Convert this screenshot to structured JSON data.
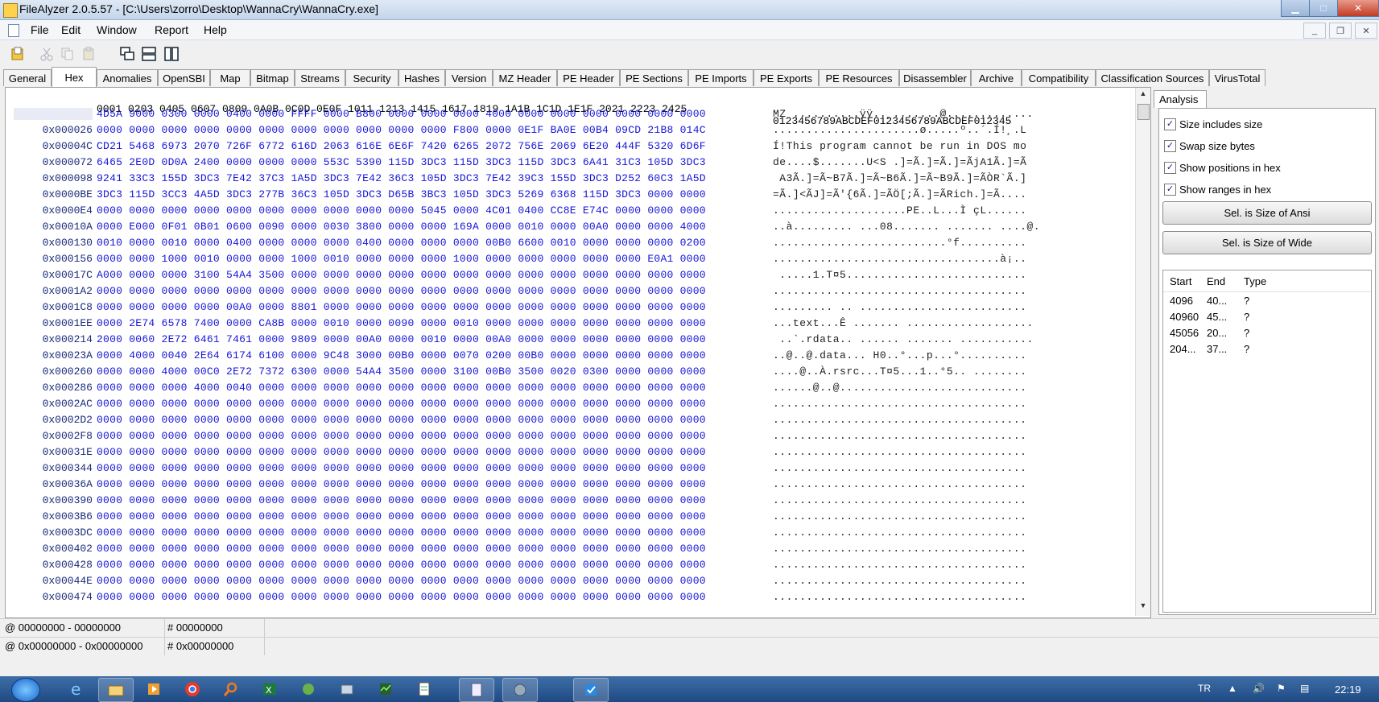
{
  "window": {
    "title": "FileAlyzer 2.0.5.57 - [C:\\Users\\zorro\\Desktop\\WannaCry\\WannaCry.exe]"
  },
  "menu": [
    "File",
    "Edit",
    "Window",
    "Report",
    "Help"
  ],
  "tabs": [
    "General",
    "Hex",
    "Anomalies",
    "OpenSBI",
    "Map",
    "Bitmap",
    "Streams",
    "Security",
    "Hashes",
    "Version",
    "MZ Header",
    "PE Header",
    "PE Sections",
    "PE Imports",
    "PE Exports",
    "PE Resources",
    "Disassembler",
    "Archive",
    "Compatibility",
    "Classification Sources",
    "VirusTotal"
  ],
  "active_tab": "Hex",
  "hex": {
    "header_hex": "0001 0203 0405 0607 0809 0A0B 0C0D 0E0F 1011 1213 1415 1617 1819 1A1B 1C1D 1E1F 2021 2223 2425",
    "header_ascii": "0123456789ABCDEF0123456789ABCDEF012345",
    "rows": [
      {
        "offset": "0x000000",
        "hex": "4D5A 9000 0300 0000 0400 0000 FFFF 0000 B800 0000 0000 0000 4000 0000 0000 0000 0000 0000 0000",
        "ascii": "MZ ..........ÿÿ..¸.......@............."
      },
      {
        "offset": "0x000026",
        "hex": "0000 0000 0000 0000 0000 0000 0000 0000 0000 0000 0000 F800 0000 0E1F BA0E 00B4 09CD 21B8 014C",
        "ascii": "......................ø.....º..´.Í!¸.L"
      },
      {
        "offset": "0x00004C",
        "hex": "CD21 5468 6973 2070 726F 6772 616D 2063 616E 6E6F 7420 6265 2072 756E 2069 6E20 444F 5320 6D6F",
        "ascii": "Í!This program cannot be run in DOS mo"
      },
      {
        "offset": "0x000072",
        "hex": "6465 2E0D 0D0A 2400 0000 0000 0000 553C 5390 115D 3DC3 115D 3DC3 115D 3DC3 6A41 31C3 105D 3DC3",
        "ascii": "de....$.......U<S .]=Ã.]=Ã.]=ÃjA1Ã.]=Ã"
      },
      {
        "offset": "0x000098",
        "hex": "9241 33C3 155D 3DC3 7E42 37C3 1A5D 3DC3 7E42 36C3 105D 3DC3 7E42 39C3 155D 3DC3 D252 60C3 1A5D",
        "ascii": " A3Ã.]=Ã~B7Ã.]=Ã~B6Ã.]=Ã~B9Ã.]=ÃÒR`Ã.]"
      },
      {
        "offset": "0x0000BE",
        "hex": "3DC3 115D 3CC3 4A5D 3DC3 277B 36C3 105D 3DC3 D65B 3BC3 105D 3DC3 5269 6368 115D 3DC3 0000 0000",
        "ascii": "=Ã.]<ÃJ]=Ã'{6Ã.]=ÃÖ[;Ã.]=ÃRich.]=Ã...."
      },
      {
        "offset": "0x0000E4",
        "hex": "0000 0000 0000 0000 0000 0000 0000 0000 0000 0000 5045 0000 4C01 0400 CC8E E74C 0000 0000 0000",
        "ascii": "....................PE..L...Ì çL......"
      },
      {
        "offset": "0x00010A",
        "hex": "0000 E000 0F01 0B01 0600 0090 0000 0030 3800 0000 0000 169A 0000 0010 0000 00A0 0000 0000 4000",
        "ascii": "..à......... ...08....... ....... ....@."
      },
      {
        "offset": "0x000130",
        "hex": "0010 0000 0010 0000 0400 0000 0000 0000 0400 0000 0000 0000 00B0 6600 0010 0000 0000 0000 0200",
        "ascii": "..........................°f.........."
      },
      {
        "offset": "0x000156",
        "hex": "0000 0000 1000 0010 0000 0000 1000 0010 0000 0000 0000 1000 0000 0000 0000 0000 0000 E0A1 0000",
        "ascii": "..................................à¡.."
      },
      {
        "offset": "0x00017C",
        "hex": "A000 0000 0000 3100 54A4 3500 0000 0000 0000 0000 0000 0000 0000 0000 0000 0000 0000 0000 0000",
        "ascii": " .....1.T¤5..........................."
      },
      {
        "offset": "0x0001A2",
        "hex": "0000 0000 0000 0000 0000 0000 0000 0000 0000 0000 0000 0000 0000 0000 0000 0000 0000 0000 0000",
        "ascii": "......................................"
      },
      {
        "offset": "0x0001C8",
        "hex": "0000 0000 0000 0000 00A0 0000 8801 0000 0000 0000 0000 0000 0000 0000 0000 0000 0000 0000 0000",
        "ascii": "......... .. ........................."
      },
      {
        "offset": "0x0001EE",
        "hex": "0000 2E74 6578 7400 0000 CA8B 0000 0010 0000 0090 0000 0010 0000 0000 0000 0000 0000 0000 0000",
        "ascii": "...text...Ê ....... ..................."
      },
      {
        "offset": "0x000214",
        "hex": "2000 0060 2E72 6461 7461 0000 9809 0000 00A0 0000 0010 0000 00A0 0000 0000 0000 0000 0000 0000",
        "ascii": " ..`.rdata.. ...... ....... ..........."
      },
      {
        "offset": "0x00023A",
        "hex": "0000 4000 0040 2E64 6174 6100 0000 9C48 3000 00B0 0000 0070 0200 00B0 0000 0000 0000 0000 0000",
        "ascii": "..@..@.data... H0..°...p...°.........."
      },
      {
        "offset": "0x000260",
        "hex": "0000 0000 4000 00C0 2E72 7372 6300 0000 54A4 3500 0000 3100 00B0 3500 0020 0300 0000 0000 0000",
        "ascii": "....@..À.rsrc...T¤5...1..°5.. ........"
      },
      {
        "offset": "0x000286",
        "hex": "0000 0000 0000 4000 0040 0000 0000 0000 0000 0000 0000 0000 0000 0000 0000 0000 0000 0000 0000",
        "ascii": "......@..@............................"
      },
      {
        "offset": "0x0002AC",
        "hex": "0000 0000 0000 0000 0000 0000 0000 0000 0000 0000 0000 0000 0000 0000 0000 0000 0000 0000 0000",
        "ascii": "......................................"
      },
      {
        "offset": "0x0002D2",
        "hex": "0000 0000 0000 0000 0000 0000 0000 0000 0000 0000 0000 0000 0000 0000 0000 0000 0000 0000 0000",
        "ascii": "......................................"
      },
      {
        "offset": "0x0002F8",
        "hex": "0000 0000 0000 0000 0000 0000 0000 0000 0000 0000 0000 0000 0000 0000 0000 0000 0000 0000 0000",
        "ascii": "......................................"
      },
      {
        "offset": "0x00031E",
        "hex": "0000 0000 0000 0000 0000 0000 0000 0000 0000 0000 0000 0000 0000 0000 0000 0000 0000 0000 0000",
        "ascii": "......................................"
      },
      {
        "offset": "0x000344",
        "hex": "0000 0000 0000 0000 0000 0000 0000 0000 0000 0000 0000 0000 0000 0000 0000 0000 0000 0000 0000",
        "ascii": "......................................"
      },
      {
        "offset": "0x00036A",
        "hex": "0000 0000 0000 0000 0000 0000 0000 0000 0000 0000 0000 0000 0000 0000 0000 0000 0000 0000 0000",
        "ascii": "......................................"
      },
      {
        "offset": "0x000390",
        "hex": "0000 0000 0000 0000 0000 0000 0000 0000 0000 0000 0000 0000 0000 0000 0000 0000 0000 0000 0000",
        "ascii": "......................................"
      },
      {
        "offset": "0x0003B6",
        "hex": "0000 0000 0000 0000 0000 0000 0000 0000 0000 0000 0000 0000 0000 0000 0000 0000 0000 0000 0000",
        "ascii": "......................................"
      },
      {
        "offset": "0x0003DC",
        "hex": "0000 0000 0000 0000 0000 0000 0000 0000 0000 0000 0000 0000 0000 0000 0000 0000 0000 0000 0000",
        "ascii": "......................................"
      },
      {
        "offset": "0x000402",
        "hex": "0000 0000 0000 0000 0000 0000 0000 0000 0000 0000 0000 0000 0000 0000 0000 0000 0000 0000 0000",
        "ascii": "......................................"
      },
      {
        "offset": "0x000428",
        "hex": "0000 0000 0000 0000 0000 0000 0000 0000 0000 0000 0000 0000 0000 0000 0000 0000 0000 0000 0000",
        "ascii": "......................................"
      },
      {
        "offset": "0x00044E",
        "hex": "0000 0000 0000 0000 0000 0000 0000 0000 0000 0000 0000 0000 0000 0000 0000 0000 0000 0000 0000",
        "ascii": "......................................"
      },
      {
        "offset": "0x000474",
        "hex": "0000 0000 0000 0000 0000 0000 0000 0000 0000 0000 0000 0000 0000 0000 0000 0000 0000 0000 0000",
        "ascii": "......................................"
      }
    ]
  },
  "analysis": {
    "tab_label": "Analysis",
    "checkboxes": [
      {
        "label": "Size includes size",
        "checked": true
      },
      {
        "label": "Swap size bytes",
        "checked": true
      },
      {
        "label": "Show positions in hex",
        "checked": true
      },
      {
        "label": "Show ranges in hex",
        "checked": true
      }
    ],
    "btn_ansi": "Sel. is Size of Ansi",
    "btn_wide": "Sel. is Size of Wide",
    "table": {
      "headers": [
        "Start",
        "End",
        "Type"
      ],
      "rows": [
        [
          "4096",
          "40...",
          "?"
        ],
        [
          "40960",
          "45...",
          "?"
        ],
        [
          "45056",
          "20...",
          "?"
        ],
        [
          "204...",
          "37...",
          "?"
        ]
      ]
    }
  },
  "status": {
    "row1_range": "@ 00000000 - 00000000",
    "row1_size": "# 00000000",
    "row2_range": "@ 0x00000000 - 0x00000000",
    "row2_size": "# 0x00000000"
  },
  "taskbar": {
    "lang": "TR",
    "clock": "22:19"
  }
}
